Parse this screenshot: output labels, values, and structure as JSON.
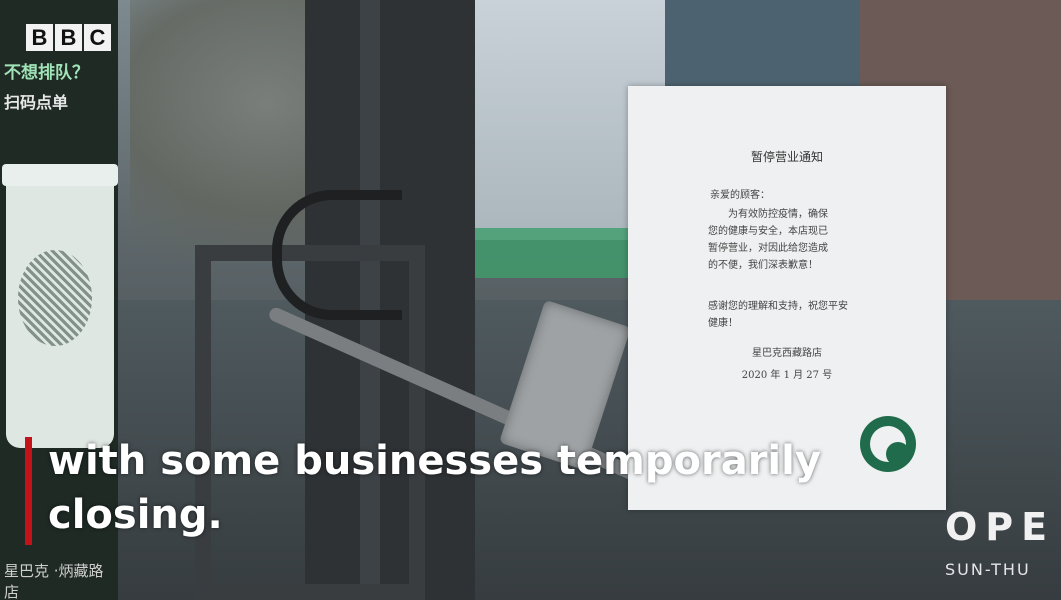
{
  "badge": {
    "letters": [
      "B",
      "B",
      "C"
    ]
  },
  "caption": {
    "line1": "with some businesses temporarily",
    "line2": "closing."
  },
  "poster": {
    "cta": "不想排队？",
    "sub": "扫码点单",
    "bottom": "星巴克 ·炳藏路店"
  },
  "notice": {
    "title": "暂停营业通知",
    "greeting": "亲爱的顾客：",
    "body": "为有效防控疫情，确保您的健康与安全，本店现已暂停营业，对因此给您造成的不便，我们深表歉意！",
    "thanks": "感谢您的理解和支持，祝您平安健康！",
    "store": "星巴克西藏路店",
    "date": "2020 年 1 月 27 号"
  },
  "door_sign": {
    "open": "OPE",
    "hours": "SUN-THU"
  }
}
